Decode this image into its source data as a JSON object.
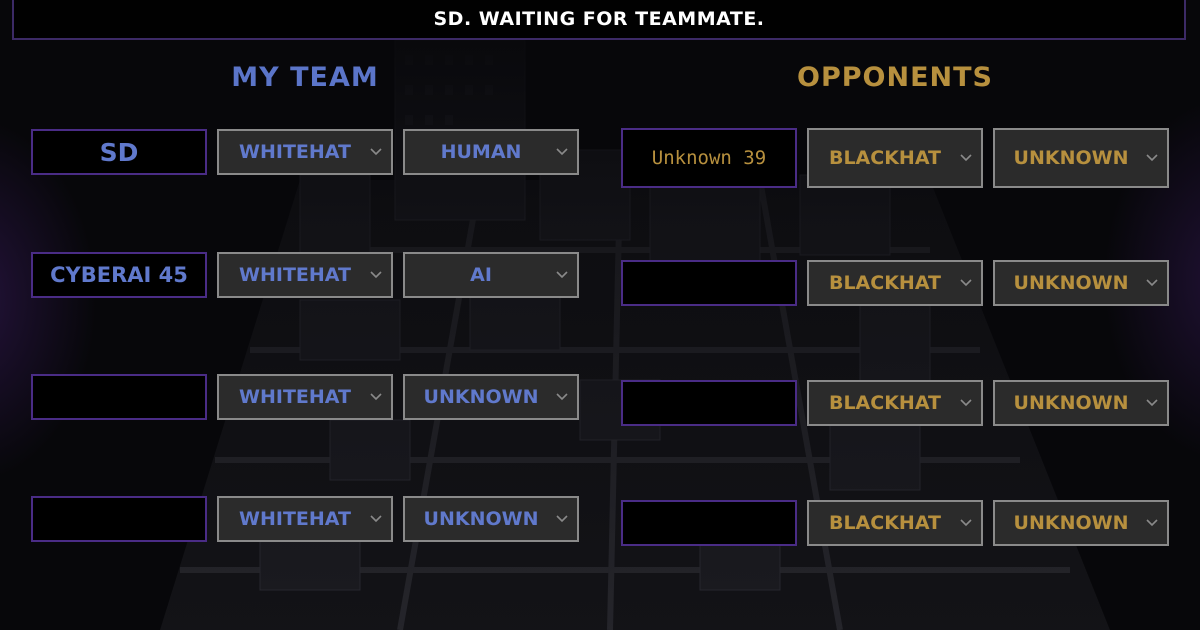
{
  "status": {
    "text": "SD. WAITING FOR TEAMMATE."
  },
  "my_team": {
    "heading": "MY TEAM",
    "rows": [
      {
        "name": "SD",
        "side": "WHITEHAT",
        "type": "HUMAN"
      },
      {
        "name": "CYBERAI 45",
        "side": "WHITEHAT",
        "type": "AI"
      },
      {
        "name": "",
        "side": "WHITEHAT",
        "type": "UNKNOWN"
      },
      {
        "name": "",
        "side": "WHITEHAT",
        "type": "UNKNOWN"
      }
    ]
  },
  "opponents": {
    "heading": "OPPONENTS",
    "rows": [
      {
        "name": "Unknown 39",
        "side": "BLACKHAT",
        "type": "UNKNOWN"
      },
      {
        "name": "",
        "side": "BLACKHAT",
        "type": "UNKNOWN"
      },
      {
        "name": "",
        "side": "BLACKHAT",
        "type": "UNKNOWN"
      },
      {
        "name": "",
        "side": "BLACKHAT",
        "type": "UNKNOWN"
      }
    ]
  },
  "colors": {
    "my_team_accent": "#5b75c9",
    "opponent_accent": "#b7903e",
    "name_border": "#4a2c86",
    "select_border": "#8a8a8a",
    "select_bg": "#2b2b2b"
  },
  "icons": {
    "select_arrow": "chevron-down-icon"
  }
}
